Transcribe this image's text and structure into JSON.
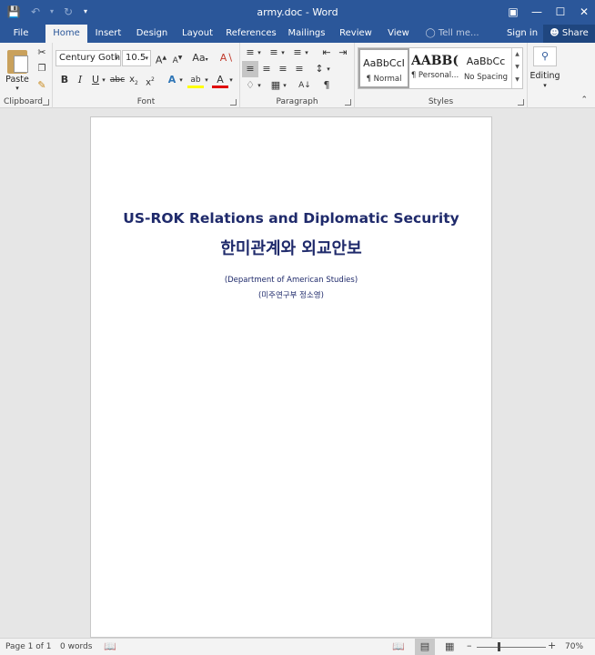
{
  "window": {
    "title": "army.doc - Word"
  },
  "tabs": [
    "File",
    "Home",
    "Insert",
    "Design",
    "Layout",
    "References",
    "Mailings",
    "Review",
    "View"
  ],
  "tell_me": "Tell me...",
  "sign_in": "Sign in",
  "share": "Share",
  "ribbon": {
    "clipboard": {
      "label": "Clipboard",
      "paste": "Paste"
    },
    "font": {
      "label": "Font",
      "font_name": "Century Gothic",
      "font_size": "10.5"
    },
    "paragraph": {
      "label": "Paragraph"
    },
    "styles": {
      "label": "Styles",
      "items": [
        {
          "preview": "AaBbCcI",
          "name": "¶ Normal"
        },
        {
          "preview": "AABB(",
          "name": "¶ Personal..."
        },
        {
          "preview": "AaBbCc",
          "name": "No Spacing"
        }
      ]
    },
    "editing": {
      "label": "Editing"
    }
  },
  "document": {
    "title_en": "US-ROK Relations and Diplomatic Security",
    "title_ko": "한미관계와 외교안보",
    "sub1": "(Department of American Studies)",
    "sub2": "(미주연구부 정소영)"
  },
  "status": {
    "page": "Page 1 of 1",
    "words": "0 words",
    "zoom": "70%"
  }
}
